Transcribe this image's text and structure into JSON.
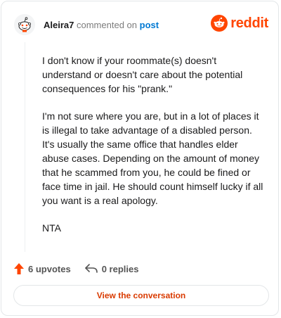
{
  "header": {
    "username": "Aleira7",
    "action_text": "commented on",
    "post_link": "post",
    "brand": "reddit"
  },
  "comment": {
    "paragraphs": [
      "I don't know if your roommate(s) doesn't understand or doesn't care about the potential consequences for his \"prank.\"",
      "I'm not sure where you are, but in a lot of places it is illegal to take advantage of a disabled person. It's usually the same office that handles elder abuse cases. Depending on the amount of money that he scammed from you, he could be fined or face time in jail. He should count himself lucky if all you want is a real apology.",
      "NTA"
    ]
  },
  "actions": {
    "upvotes": "6 upvotes",
    "replies": "0 replies"
  },
  "cta_label": "View the conversation",
  "colors": {
    "brand": "#ff4500",
    "link": "#0079d3",
    "cta_text": "#d93a00",
    "upvote": "#ff4500"
  },
  "icons": {
    "avatar": "snoo-avatar-icon",
    "logo": "reddit-logo-icon",
    "upvote": "upvote-arrow-icon",
    "reply": "reply-arrow-icon"
  }
}
